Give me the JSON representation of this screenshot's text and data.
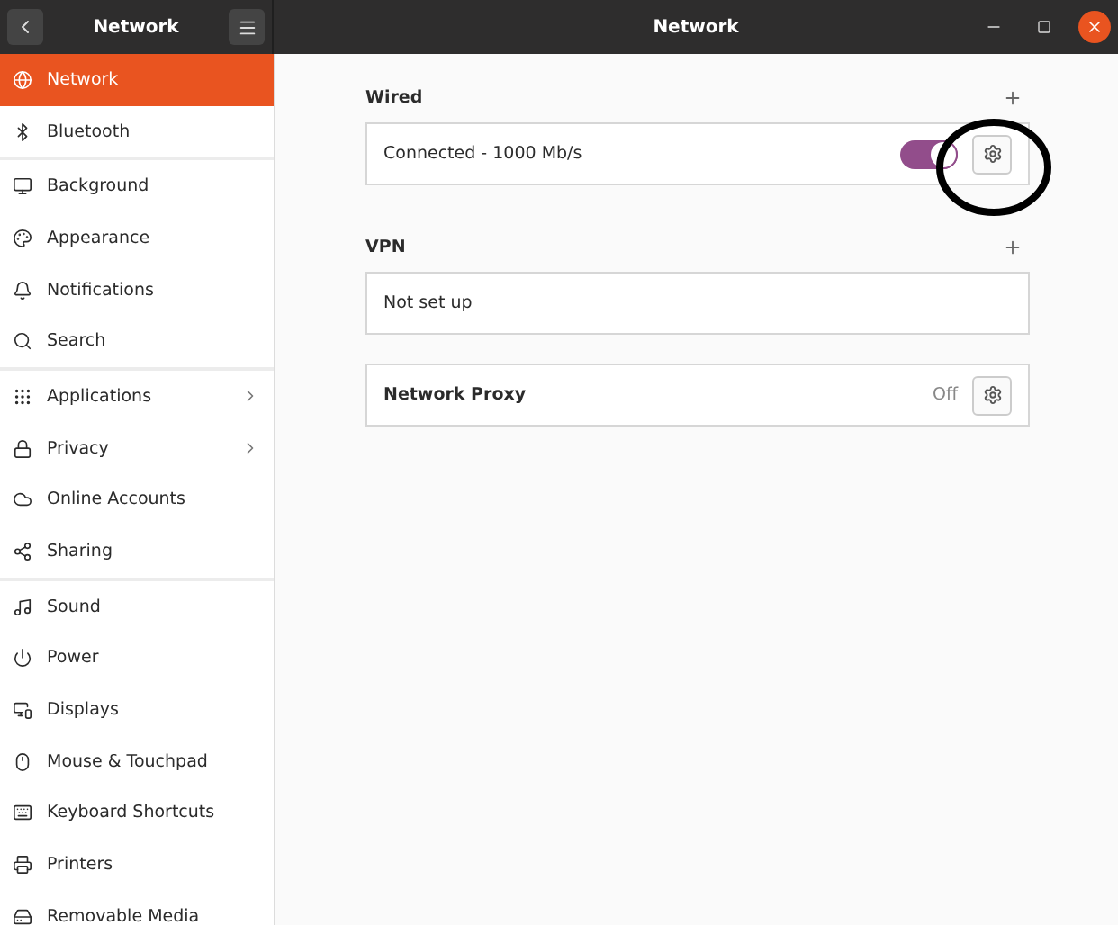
{
  "header": {
    "sidebar_title": "Network",
    "title": "Network"
  },
  "sidebar": {
    "groups": [
      [
        {
          "label": "Network",
          "selected": true,
          "submenu": false
        },
        {
          "label": "Bluetooth",
          "selected": false,
          "submenu": false
        }
      ],
      [
        {
          "label": "Background",
          "selected": false,
          "submenu": false
        },
        {
          "label": "Appearance",
          "selected": false,
          "submenu": false
        },
        {
          "label": "Notifications",
          "selected": false,
          "submenu": false
        },
        {
          "label": "Search",
          "selected": false,
          "submenu": false
        }
      ],
      [
        {
          "label": "Applications",
          "selected": false,
          "submenu": true
        },
        {
          "label": "Privacy",
          "selected": false,
          "submenu": true
        },
        {
          "label": "Online Accounts",
          "selected": false,
          "submenu": false
        },
        {
          "label": "Sharing",
          "selected": false,
          "submenu": false
        }
      ],
      [
        {
          "label": "Sound",
          "selected": false,
          "submenu": false
        },
        {
          "label": "Power",
          "selected": false,
          "submenu": false
        },
        {
          "label": "Displays",
          "selected": false,
          "submenu": false
        },
        {
          "label": "Mouse & Touchpad",
          "selected": false,
          "submenu": false
        },
        {
          "label": "Keyboard Shortcuts",
          "selected": false,
          "submenu": false
        },
        {
          "label": "Printers",
          "selected": false,
          "submenu": false
        },
        {
          "label": "Removable Media",
          "selected": false,
          "submenu": false
        }
      ]
    ]
  },
  "wired": {
    "heading": "Wired",
    "status": "Connected - 1000 Mb/s",
    "on": true
  },
  "vpn": {
    "heading": "VPN",
    "status": "Not set up"
  },
  "proxy": {
    "label": "Network Proxy",
    "status": "Off"
  }
}
